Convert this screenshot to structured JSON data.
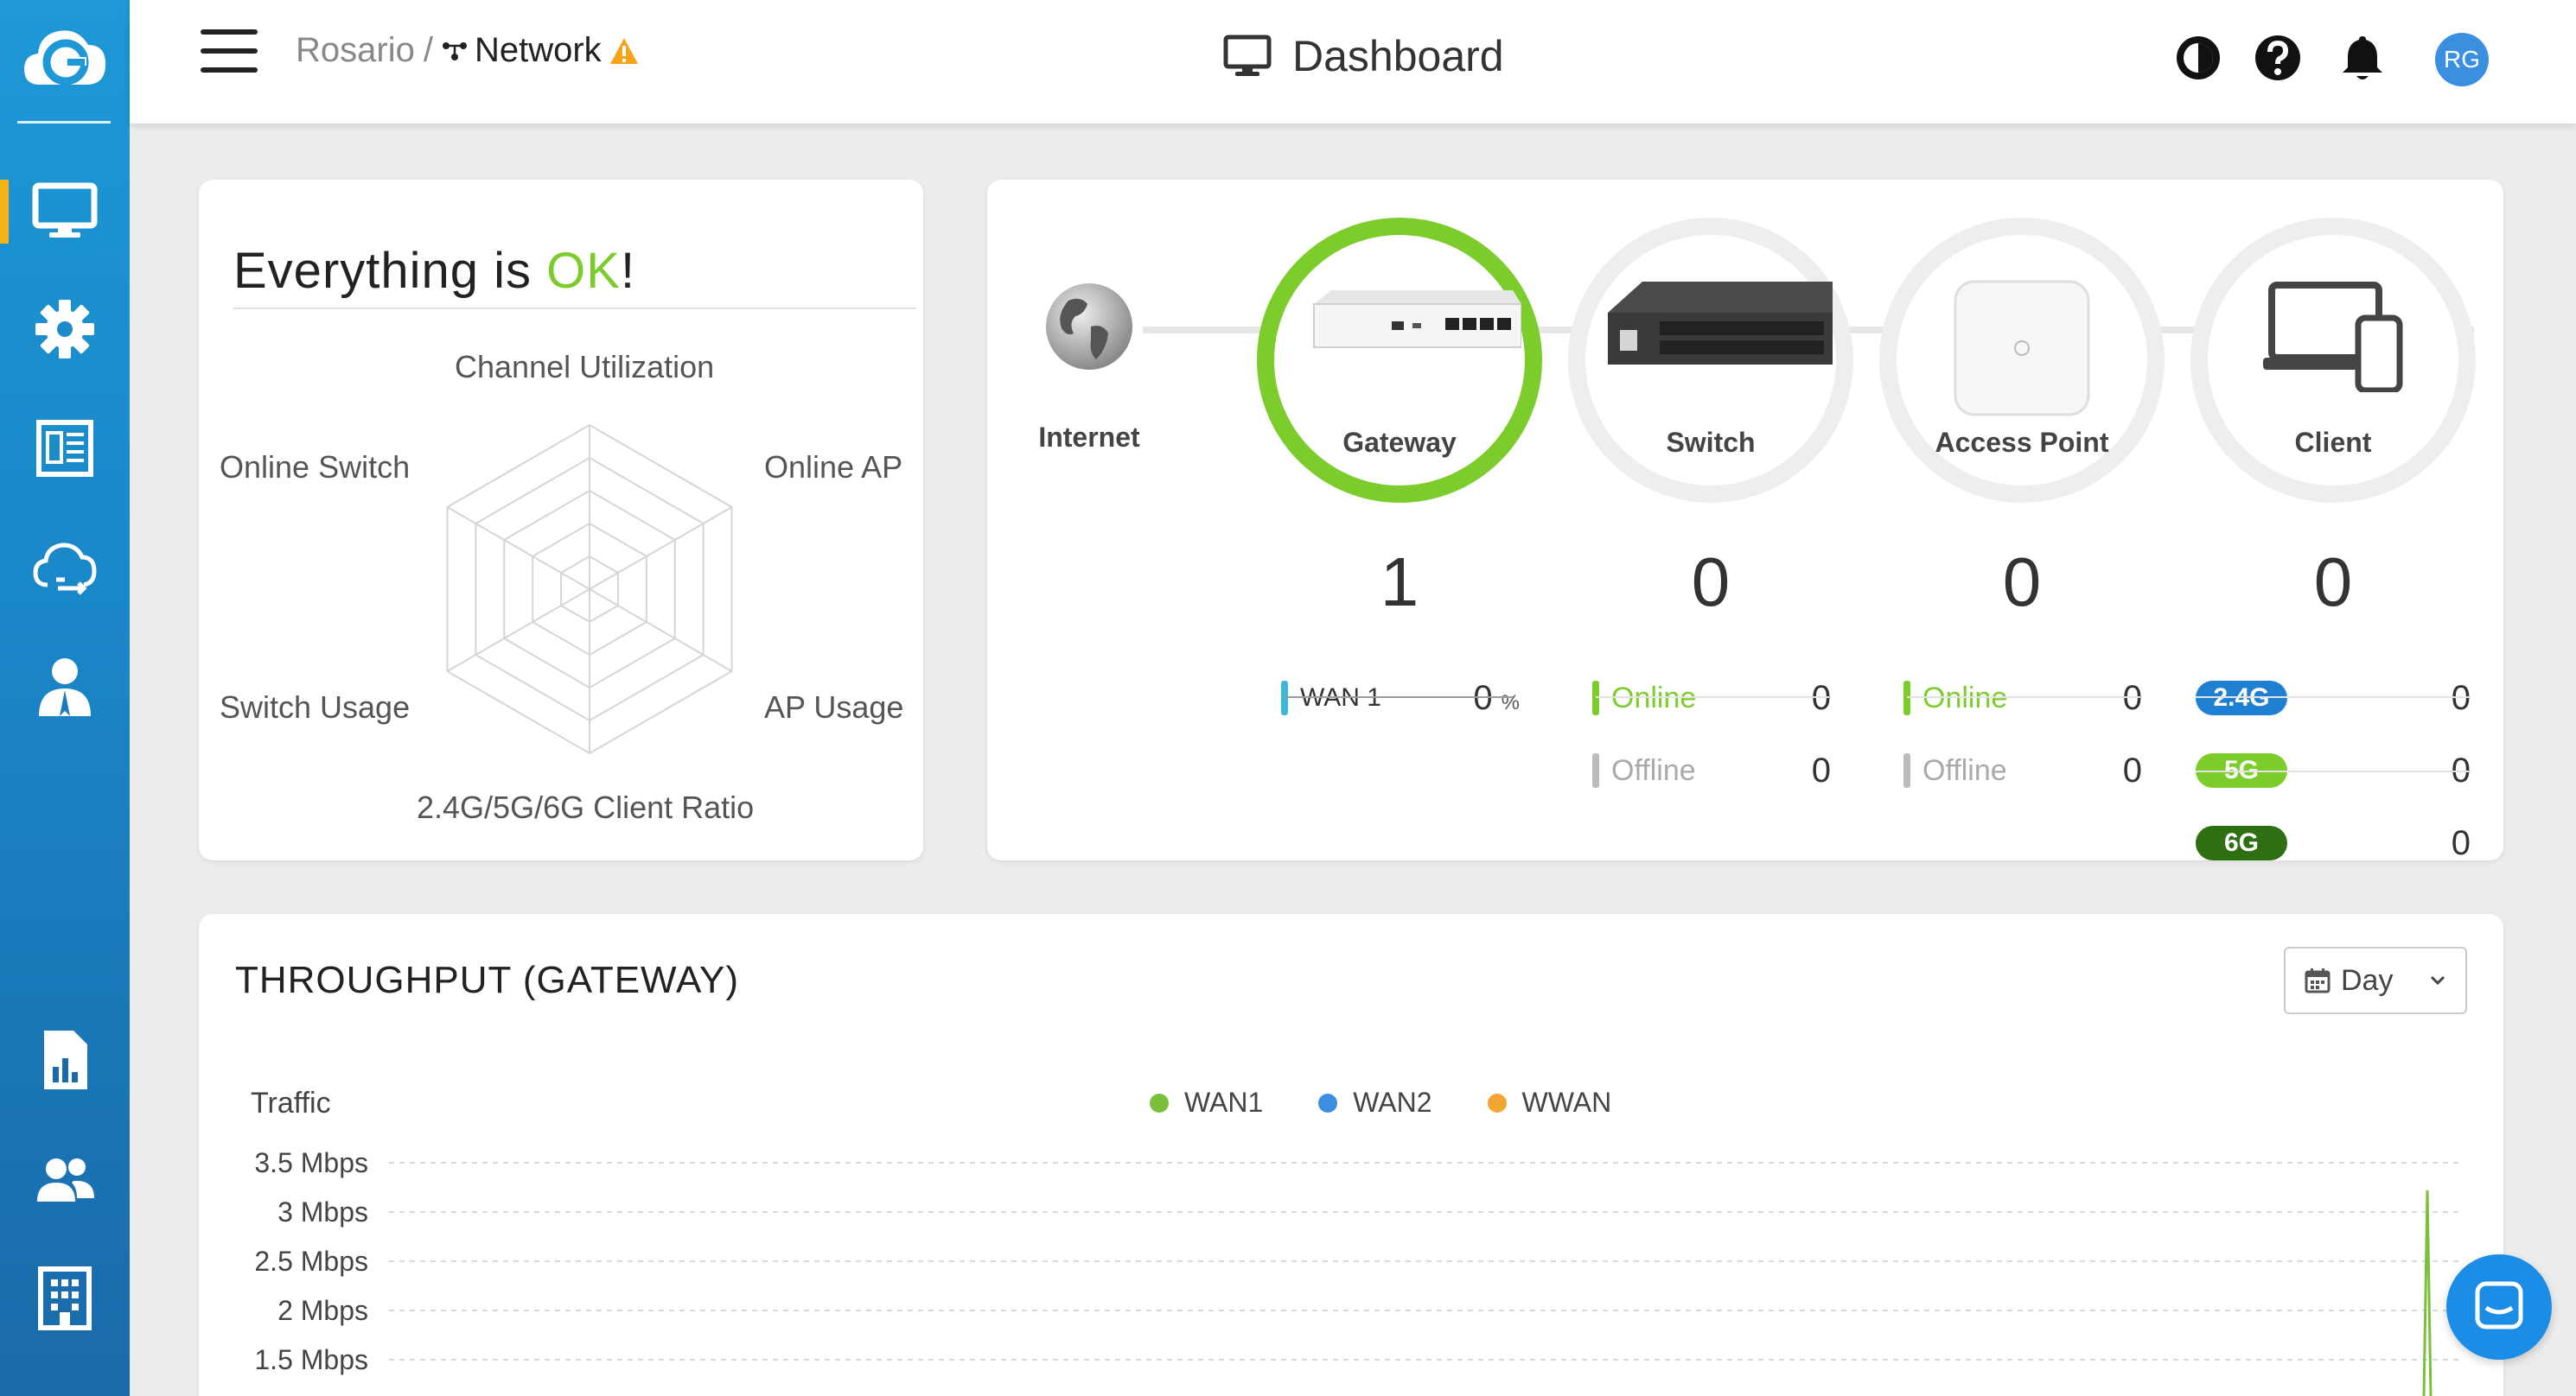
{
  "topbar": {
    "breadcrumb_root": "Rosario",
    "breadcrumb_sep": "/",
    "breadcrumb_current": "Network",
    "page_title": "Dashboard",
    "avatar_initials": "RG"
  },
  "sidebar": {
    "items": [
      {
        "name": "dashboard",
        "icon": "monitor-icon",
        "active": true
      },
      {
        "name": "settings",
        "icon": "gear-icon"
      },
      {
        "name": "monitor",
        "icon": "list-icon"
      },
      {
        "name": "cloud",
        "icon": "cloud-sync-icon"
      },
      {
        "name": "account",
        "icon": "user-icon"
      },
      {
        "name": "reports",
        "icon": "report-icon"
      },
      {
        "name": "users",
        "icon": "users-icon"
      },
      {
        "name": "organization",
        "icon": "building-icon"
      }
    ]
  },
  "health": {
    "title_prefix": "Everything is ",
    "title_ok": "OK",
    "title_suffix": "!",
    "radar_labels": {
      "top": "Channel Utilization",
      "top_right": "Online AP",
      "bottom_right": "AP Usage",
      "bottom": "2.4G/5G/6G Client Ratio",
      "bottom_left": "Switch Usage",
      "top_left": "Online Switch"
    }
  },
  "network": {
    "internet_label": "Internet",
    "gateway": {
      "label": "Gateway",
      "count": "1",
      "wan_label": "WAN 1",
      "wan_value": "0",
      "wan_unit": "%"
    },
    "switch": {
      "label": "Switch",
      "count": "0",
      "online_label": "Online",
      "online_value": "0",
      "offline_label": "Offline",
      "offline_value": "0"
    },
    "ap": {
      "label": "Access Point",
      "count": "0",
      "online_label": "Online",
      "online_value": "0",
      "offline_label": "Offline",
      "offline_value": "0"
    },
    "client": {
      "label": "Client",
      "count": "0",
      "bands": [
        {
          "label": "2.4G",
          "value": "0",
          "color": "#1f7fd1"
        },
        {
          "label": "5G",
          "value": "0",
          "color": "#7ccc2c"
        },
        {
          "label": "6G",
          "value": "0",
          "color": "#2e6f14"
        }
      ]
    },
    "colors": {
      "online": "#7ccc2c",
      "offline": "#bbbbbb",
      "wan_bar": "#3bb8d8"
    }
  },
  "throughput": {
    "title": "THROUGHPUT (GATEWAY)",
    "range_label": "Day",
    "y_title": "Traffic",
    "legend": [
      {
        "label": "WAN1",
        "color": "#7cbf3a"
      },
      {
        "label": "WAN2",
        "color": "#3d8fe0"
      },
      {
        "label": "WWAN",
        "color": "#f2a632"
      }
    ],
    "y_ticks": [
      "3.5 Mbps",
      "3 Mbps",
      "2.5 Mbps",
      "2 Mbps",
      "1.5 Mbps"
    ]
  },
  "chart_data": {
    "type": "line",
    "title": "THROUGHPUT (GATEWAY)",
    "ylabel": "Traffic",
    "y_ticks": [
      "3.5 Mbps",
      "3 Mbps",
      "2.5 Mbps",
      "2 Mbps",
      "1.5 Mbps"
    ],
    "series": [
      {
        "name": "WAN1",
        "color": "#7cbf3a"
      },
      {
        "name": "WAN2",
        "color": "#3d8fe0"
      },
      {
        "name": "WWAN",
        "color": "#f2a632"
      }
    ],
    "grid": true,
    "legend": "top-center"
  }
}
